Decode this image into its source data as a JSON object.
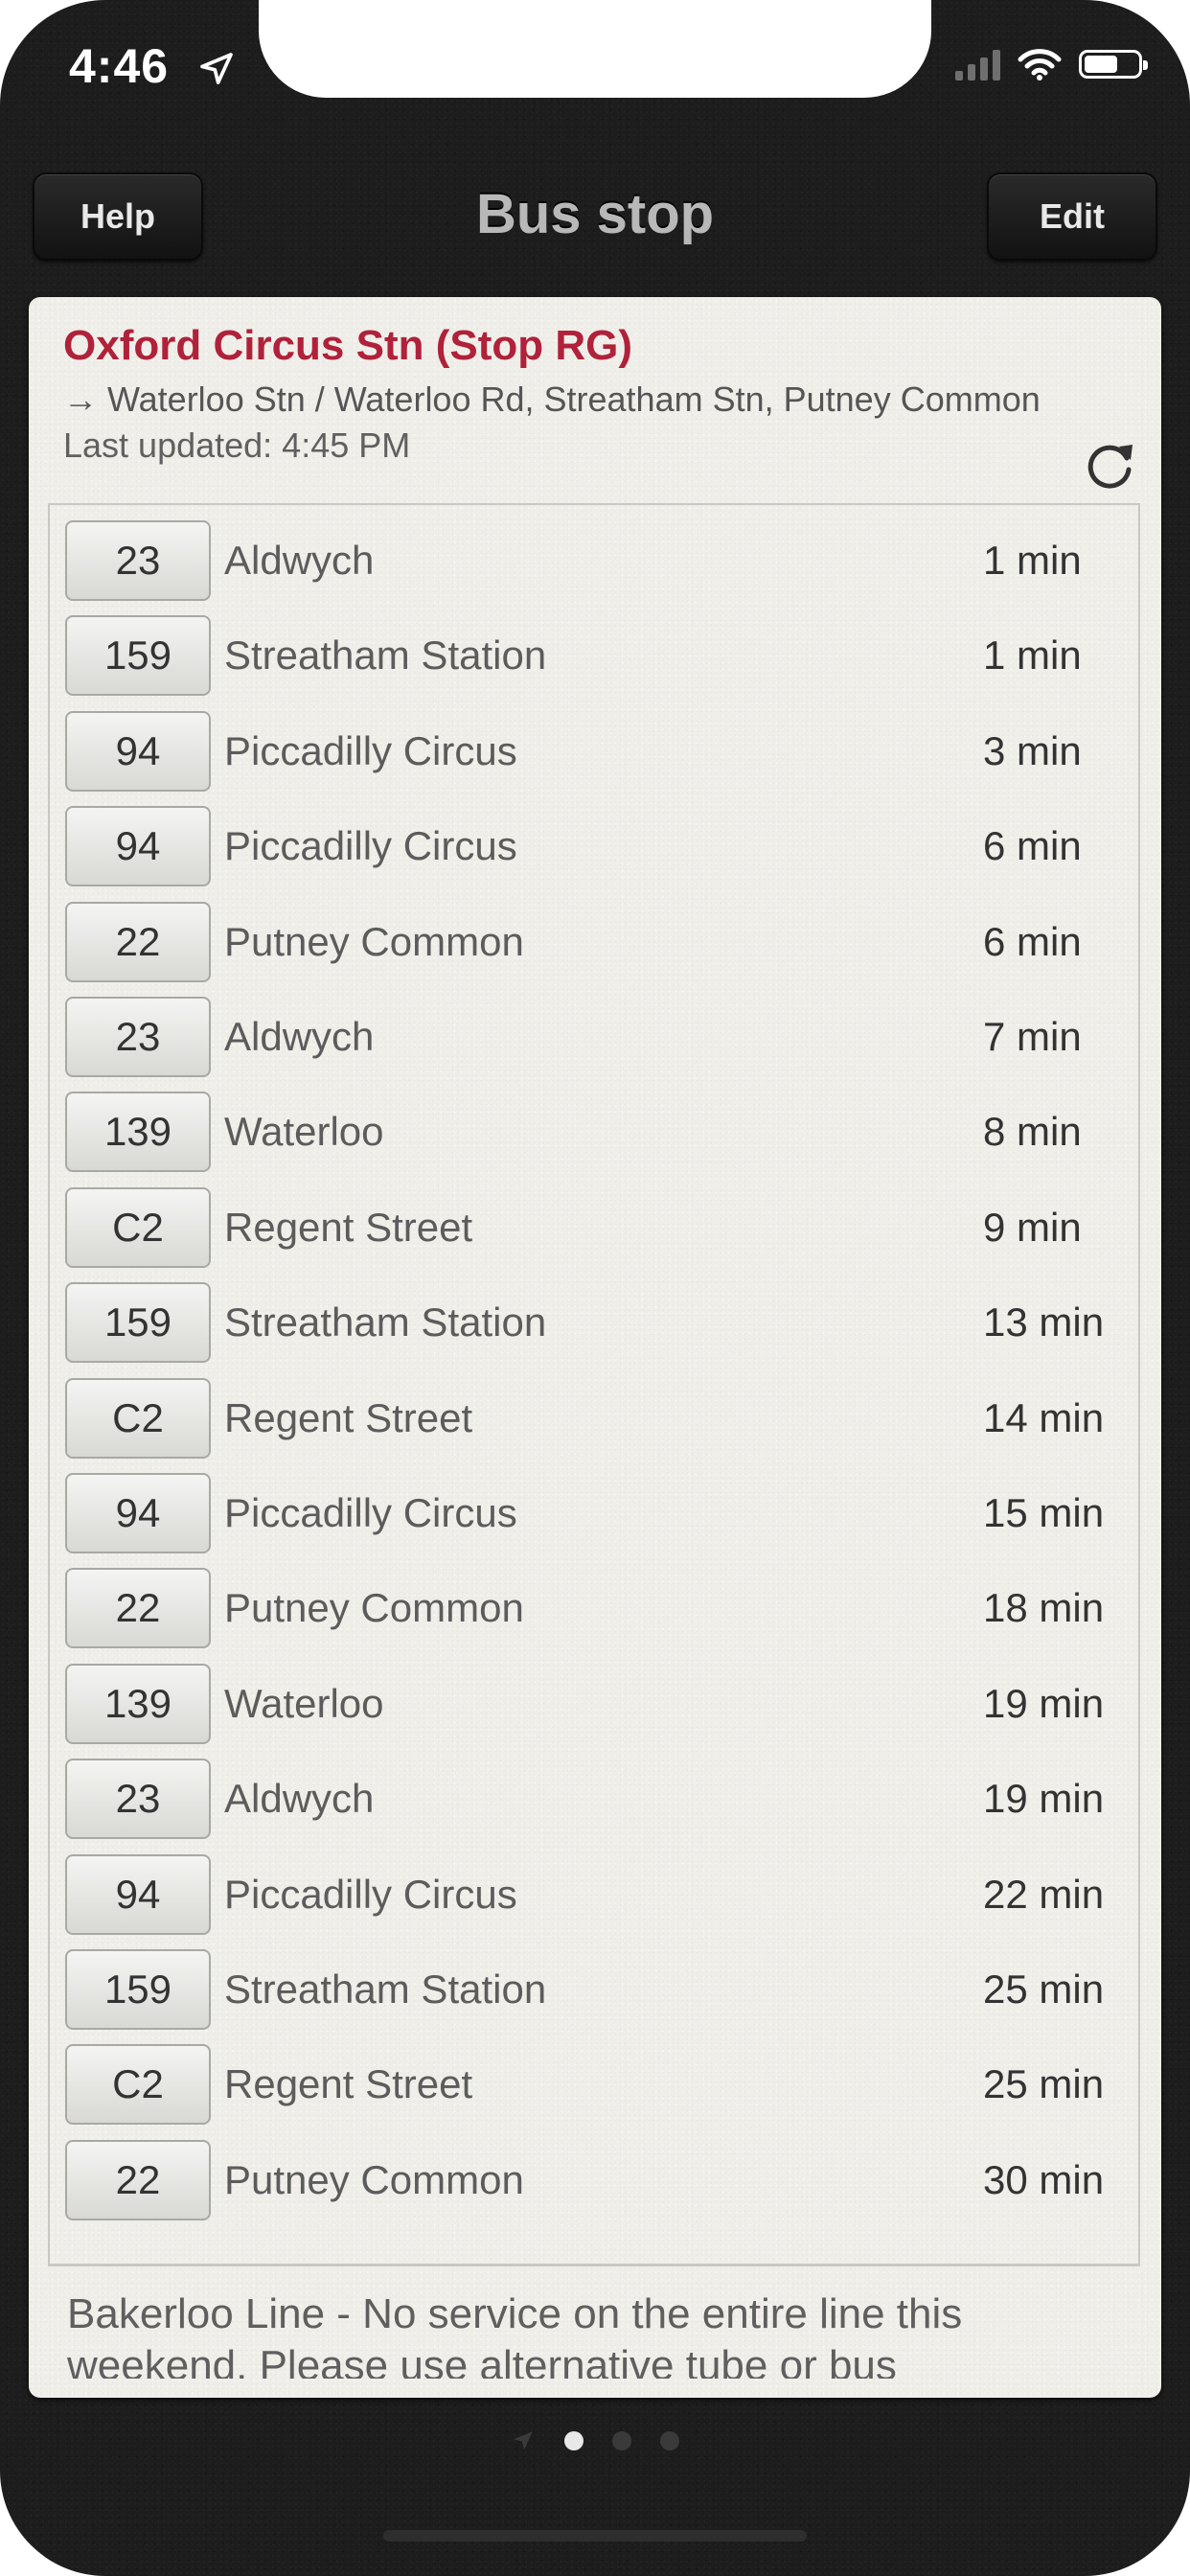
{
  "status_bar": {
    "time": "4:46"
  },
  "nav": {
    "title": "Bus stop",
    "help_label": "Help",
    "edit_label": "Edit"
  },
  "stop": {
    "name": "Oxford Circus Stn (Stop RG)",
    "directions": "→ Waterloo Stn / Waterloo Rd, Streatham Stn, Putney Common",
    "last_updated": "Last updated: 4:45 PM"
  },
  "arrivals": [
    {
      "route": "23",
      "destination": "Aldwych",
      "eta": "1 min"
    },
    {
      "route": "159",
      "destination": "Streatham Station",
      "eta": "1 min"
    },
    {
      "route": "94",
      "destination": "Piccadilly Circus",
      "eta": "3 min"
    },
    {
      "route": "94",
      "destination": "Piccadilly Circus",
      "eta": "6 min"
    },
    {
      "route": "22",
      "destination": "Putney Common",
      "eta": "6 min"
    },
    {
      "route": "23",
      "destination": "Aldwych",
      "eta": "7 min"
    },
    {
      "route": "139",
      "destination": "Waterloo",
      "eta": "8 min"
    },
    {
      "route": "C2",
      "destination": "Regent Street",
      "eta": "9 min"
    },
    {
      "route": "159",
      "destination": "Streatham Station",
      "eta": "13 min"
    },
    {
      "route": "C2",
      "destination": "Regent Street",
      "eta": "14 min"
    },
    {
      "route": "94",
      "destination": "Piccadilly Circus",
      "eta": "15 min"
    },
    {
      "route": "22",
      "destination": "Putney Common",
      "eta": "18 min"
    },
    {
      "route": "139",
      "destination": "Waterloo",
      "eta": "19 min"
    },
    {
      "route": "23",
      "destination": "Aldwych",
      "eta": "19 min"
    },
    {
      "route": "94",
      "destination": "Piccadilly Circus",
      "eta": "22 min"
    },
    {
      "route": "159",
      "destination": "Streatham Station",
      "eta": "25 min"
    },
    {
      "route": "C2",
      "destination": "Regent Street",
      "eta": "25 min"
    },
    {
      "route": "22",
      "destination": "Putney Common",
      "eta": "30 min"
    }
  ],
  "alert": {
    "text": "Bakerloo Line - No service on the entire line this weekend. Please use alternative tube or bus"
  },
  "pager": {
    "active_index": 0,
    "page_count": 3
  },
  "colors": {
    "stop_name": "#b0213a",
    "card_bg": "#efeee9",
    "background": "#1d1d1d"
  }
}
